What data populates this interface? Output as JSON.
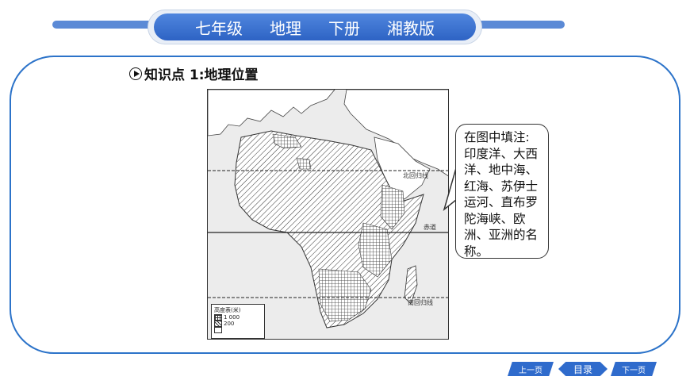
{
  "header": {
    "grade": "七年级",
    "subject": "地理",
    "volume": "下册",
    "edition": "湘教版"
  },
  "knowledge_point": {
    "title": "知识点 1:地理位置"
  },
  "map": {
    "latitude_labels": {
      "tropic_of_cancer": "北回归线",
      "equator": "赤道",
      "tropic_of_capricorn": "南回归线"
    },
    "legend": {
      "title": "高度表(米)",
      "levels": [
        "1 000",
        "200"
      ]
    }
  },
  "bubble": {
    "lines": [
      "在图中填注:",
      "印度洋、大西",
      "洋、地中海、",
      "红海、苏伊士",
      "运河、直布罗",
      "陀海峡、欧",
      "洲、亚洲的名",
      "称。"
    ]
  },
  "nav": {
    "prev": "上一页",
    "toc": "目录",
    "next": "下一页"
  },
  "colors": {
    "accent": "#2c73c9",
    "header_band": "#5b8ad6"
  }
}
